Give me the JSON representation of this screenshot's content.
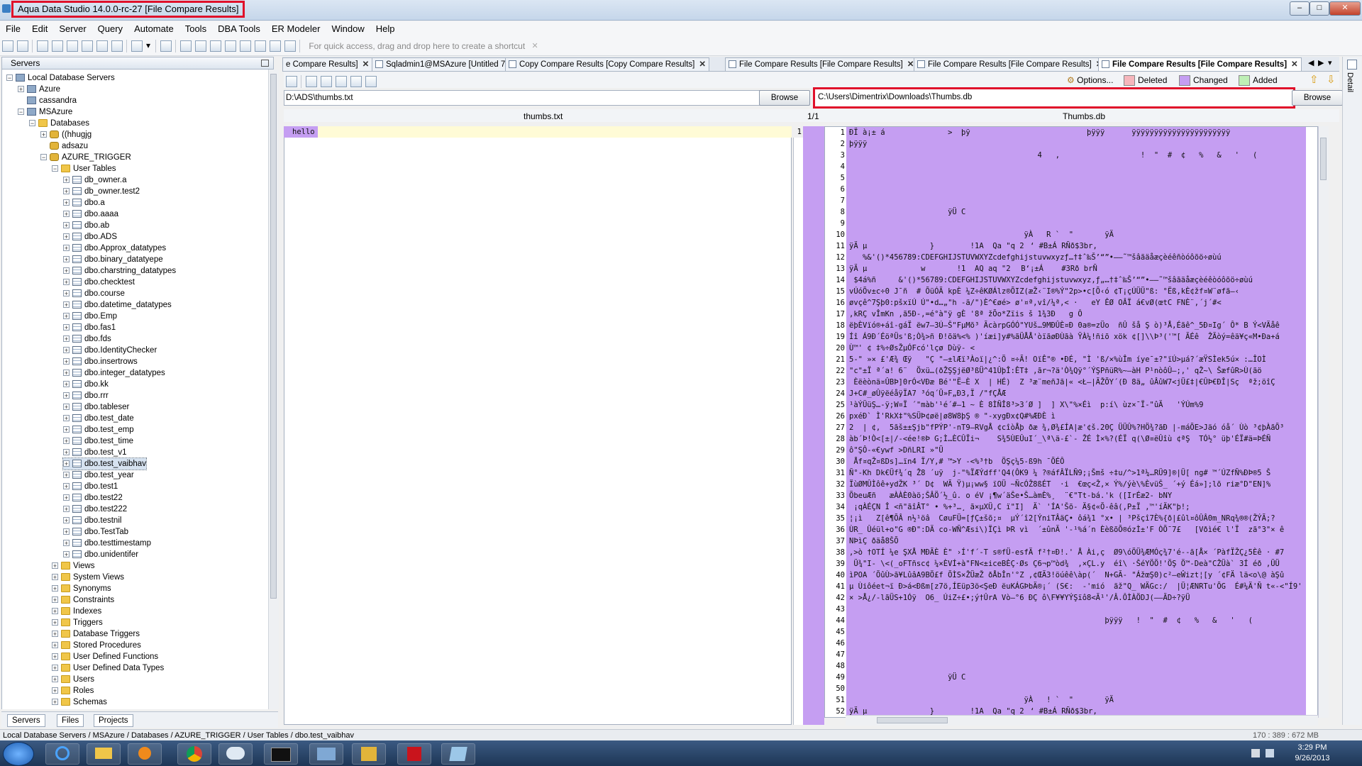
{
  "window": {
    "title": "Aqua Data Studio 14.0.0-rc-27 [File Compare Results]",
    "controls": [
      "–",
      "□",
      "✕"
    ]
  },
  "menu": [
    "File",
    "Edit",
    "Server",
    "Query",
    "Automate",
    "Tools",
    "DBA Tools",
    "ER Modeler",
    "Window",
    "Help"
  ],
  "toolbar": {
    "shortcut_hint": "For quick access, drag and drop here to create a shortcut",
    "close_x": "✕"
  },
  "servers_panel": {
    "title": "Servers",
    "tree": [
      {
        "label": "Local Database Servers",
        "level": 0,
        "icon": "server-icon",
        "expand": "−"
      },
      {
        "label": "Azure",
        "level": 1,
        "icon": "server-icon",
        "expand": "+"
      },
      {
        "label": "cassandra",
        "level": 1,
        "icon": "server-icon",
        "expand": ""
      },
      {
        "label": "MSAzure",
        "level": 1,
        "icon": "server-icon",
        "expand": "−"
      },
      {
        "label": "Databases",
        "level": 2,
        "icon": "folder-icon",
        "expand": "−"
      },
      {
        "label": "((hhugjg",
        "level": 3,
        "icon": "database-icon",
        "expand": "+"
      },
      {
        "label": "adsazu",
        "level": 3,
        "icon": "database-icon",
        "expand": ""
      },
      {
        "label": "AZURE_TRIGGER",
        "level": 3,
        "icon": "database-icon",
        "expand": "−"
      },
      {
        "label": "User Tables",
        "level": 4,
        "icon": "folder-icon",
        "expand": "−"
      },
      {
        "label": "db_owner.a",
        "level": 5,
        "icon": "table-icon",
        "expand": "+"
      },
      {
        "label": "db_owner.test2",
        "level": 5,
        "icon": "table-icon",
        "expand": "+"
      },
      {
        "label": "dbo.a",
        "level": 5,
        "icon": "table-icon",
        "expand": "+"
      },
      {
        "label": "dbo.aaaa",
        "level": 5,
        "icon": "table-icon",
        "expand": "+"
      },
      {
        "label": "dbo.ab",
        "level": 5,
        "icon": "table-icon",
        "expand": "+"
      },
      {
        "label": "dbo.ADS",
        "level": 5,
        "icon": "table-icon",
        "expand": "+"
      },
      {
        "label": "dbo.Approx_datatypes",
        "level": 5,
        "icon": "table-icon",
        "expand": "+"
      },
      {
        "label": "dbo.binary_datatyepe",
        "level": 5,
        "icon": "table-icon",
        "expand": "+"
      },
      {
        "label": "dbo.charstring_datatypes",
        "level": 5,
        "icon": "table-icon",
        "expand": "+"
      },
      {
        "label": "dbo.checktest",
        "level": 5,
        "icon": "table-icon",
        "expand": "+"
      },
      {
        "label": "dbo.course",
        "level": 5,
        "icon": "table-icon",
        "expand": "+"
      },
      {
        "label": "dbo.datetime_datatypes",
        "level": 5,
        "icon": "table-icon",
        "expand": "+"
      },
      {
        "label": "dbo.Emp",
        "level": 5,
        "icon": "table-icon",
        "expand": "+"
      },
      {
        "label": "dbo.fas1",
        "level": 5,
        "icon": "table-icon",
        "expand": "+"
      },
      {
        "label": "dbo.fds",
        "level": 5,
        "icon": "table-icon",
        "expand": "+"
      },
      {
        "label": "dbo.IdentityChecker",
        "level": 5,
        "icon": "table-icon",
        "expand": "+"
      },
      {
        "label": "dbo.insertrows",
        "level": 5,
        "icon": "table-icon",
        "expand": "+"
      },
      {
        "label": "dbo.integer_datatypes",
        "level": 5,
        "icon": "table-icon",
        "expand": "+"
      },
      {
        "label": "dbo.kk",
        "level": 5,
        "icon": "table-icon",
        "expand": "+"
      },
      {
        "label": "dbo.rrr",
        "level": 5,
        "icon": "table-icon",
        "expand": "+"
      },
      {
        "label": "dbo.tableser",
        "level": 5,
        "icon": "table-icon",
        "expand": "+"
      },
      {
        "label": "dbo.test_date",
        "level": 5,
        "icon": "table-icon",
        "expand": "+"
      },
      {
        "label": "dbo.test_emp",
        "level": 5,
        "icon": "table-icon",
        "expand": "+"
      },
      {
        "label": "dbo.test_time",
        "level": 5,
        "icon": "table-icon",
        "expand": "+"
      },
      {
        "label": "dbo.test_v1",
        "level": 5,
        "icon": "table-icon",
        "expand": "+"
      },
      {
        "label": "dbo.test_vaibhav",
        "level": 5,
        "icon": "table-icon",
        "expand": "+",
        "selected": true
      },
      {
        "label": "dbo.test_year",
        "level": 5,
        "icon": "table-icon",
        "expand": "+"
      },
      {
        "label": "dbo.test1",
        "level": 5,
        "icon": "table-icon",
        "expand": "+"
      },
      {
        "label": "dbo.test22",
        "level": 5,
        "icon": "table-icon",
        "expand": "+"
      },
      {
        "label": "dbo.test222",
        "level": 5,
        "icon": "table-icon",
        "expand": "+"
      },
      {
        "label": "dbo.testnil",
        "level": 5,
        "icon": "table-icon",
        "expand": "+"
      },
      {
        "label": "dbo.TestTab",
        "level": 5,
        "icon": "table-icon",
        "expand": "+"
      },
      {
        "label": "dbo.testtimestamp",
        "level": 5,
        "icon": "table-icon",
        "expand": "+"
      },
      {
        "label": "dbo.unidentifer",
        "level": 5,
        "icon": "table-icon",
        "expand": "+"
      },
      {
        "label": "Views",
        "level": 4,
        "icon": "folder-icon",
        "expand": "+"
      },
      {
        "label": "System Views",
        "level": 4,
        "icon": "folder-icon",
        "expand": "+"
      },
      {
        "label": "Synonyms",
        "level": 4,
        "icon": "folder-icon",
        "expand": "+"
      },
      {
        "label": "Constraints",
        "level": 4,
        "icon": "folder-icon",
        "expand": "+"
      },
      {
        "label": "Indexes",
        "level": 4,
        "icon": "folder-icon",
        "expand": "+"
      },
      {
        "label": "Triggers",
        "level": 4,
        "icon": "folder-icon",
        "expand": "+"
      },
      {
        "label": "Database Triggers",
        "level": 4,
        "icon": "folder-icon",
        "expand": "+"
      },
      {
        "label": "Stored Procedures",
        "level": 4,
        "icon": "folder-icon",
        "expand": "+"
      },
      {
        "label": "User Defined Functions",
        "level": 4,
        "icon": "folder-icon",
        "expand": "+"
      },
      {
        "label": "User Defined Data Types",
        "level": 4,
        "icon": "folder-icon",
        "expand": "+"
      },
      {
        "label": "Users",
        "level": 4,
        "icon": "folder-icon",
        "expand": "+"
      },
      {
        "label": "Roles",
        "level": 4,
        "icon": "folder-icon",
        "expand": "+"
      },
      {
        "label": "Schemas",
        "level": 4,
        "icon": "folder-icon",
        "expand": "+"
      }
    ],
    "bottom_tabs": [
      "Servers",
      "Files",
      "Projects"
    ]
  },
  "doc_tabs": [
    {
      "label": "e Compare Results]",
      "active": false
    },
    {
      "label": "Sqladmin1@MSAzure [Untitled 7]*",
      "active": false
    },
    {
      "label": "Copy Compare Results [Copy Compare Results]",
      "active": false
    },
    {
      "label": "File Compare Results [File Compare Results]",
      "active": false
    },
    {
      "label": "File Compare Results [File Compare Results]",
      "active": false
    },
    {
      "label": "File Compare Results [File Compare Results]",
      "active": true
    }
  ],
  "compare": {
    "options_label": "Options...",
    "legend": [
      {
        "label": "Deleted",
        "color": "#f6b6bc"
      },
      {
        "label": "Changed",
        "color": "#c59ef2"
      },
      {
        "label": "Added",
        "color": "#bff0b6"
      }
    ],
    "left_path": "D:\\ADS\\thumbs.txt",
    "right_path": "C:\\Users\\Dimentrix\\Downloads\\Thumbs.db",
    "browse_label": "Browse",
    "left_filename": "thumbs.txt",
    "right_filename": "Thumbs.db",
    "page_indicator": "1/1",
    "left_lines": [
      {
        "num": "1",
        "text": "hello"
      }
    ],
    "right_lines": [
      {
        "num": "1",
        "text": "ÐÏ à¡± á              >  þÿ                          þÿÿÿ      ÿÿÿÿÿÿÿÿÿÿÿÿÿÿÿÿÿÿÿÿÿÿ"
      },
      {
        "num": "2",
        "text": "þÿÿÿ"
      },
      {
        "num": "3",
        "text": "                                          4   ,                  !  \"  #  ¢   %   &   '   ("
      },
      {
        "num": "4",
        "text": ""
      },
      {
        "num": "5",
        "text": ""
      },
      {
        "num": "6",
        "text": ""
      },
      {
        "num": "7",
        "text": ""
      },
      {
        "num": "8",
        "text": "                      ÿÜ C"
      },
      {
        "num": "9",
        "text": ""
      },
      {
        "num": "10",
        "text": "                                       ÿÀ   R `  \"       ÿÄ"
      },
      {
        "num": "11",
        "text": "ÿÄ µ              }        !1A  Qa \"q 2‘ #B±Á RÑð$3br‚"
      },
      {
        "num": "12",
        "text": "   %&'()*456789:CDEFGHIJSTUVWXYZcdefghijstuvwxyzƒ…†‡ˆ‰Š’“”•–—˜™šâãäåæçèéêñòóôõö÷øùú"
      },
      {
        "num": "13",
        "text": "ÿÄ µ            w       !1  AQ aq \"2 B‘¡±Á    #3Rð brÑ"
      },
      {
        "num": "14",
        "text": " $4á%ñ     &'()*56789:CDEFGHIJSTUVWXYZcdefghijstuvwxyz‚ƒ„…†‡ˆ‰Š’“”•–—˜™šâãäåæçèéêòóôõö÷øùú"
      },
      {
        "num": "15",
        "text": "vÚóÕv±c÷0 J¯ñ  # ÕüÓÄ kpÈ ¼Z÷êKØÁlz®ÕIZ(æŽ‹¨I®%Ý\"2p>•c[Õ‹ó ¢T¡çÚÜÜ\"ß: °Ëß,kÈ¢žf¤W¨øfã—‹"
      },
      {
        "num": "16",
        "text": "øvçê^7Şþ0:pšxïÚ Ú\"•d…„\"h -ä/\")È^€øé> ø'¤ª,vî/¼ª‚< ·   eY ÊØ OÂÏ á€vØ(œtC FNÈ¨,´j´#<"
      },
      {
        "num": "17",
        "text": ",kRÇ vÎmKn ,ã5Ð-,=é°à\"ÿ gÈ '8ª žÕo*Zïis š 1¾3Ð   g Ô"
      },
      {
        "num": "18",
        "text": "ëþÈVïó®+áî-gáÏ ëw7—3Ú—Š\"FµMõ³ ÃcàrpGÓÓ\"YUš…9MÐÛÈ¤Ð 0a®=zÜo  ñÛ šå Ş ò)³Å,Éãê^_5Ð¤Ig´ Ô* B Ý<VÄåê"
      },
      {
        "num": "19",
        "text": "Íî Á9Ð´ÉöªÜs'ß;Ò¾>ñ Ð!õä%<% )'íæi]y#%ãÜÅÅ'òïãøÐÙãà ŸÀ¼!ñiõ xök ¢[]\\\\Þ³('™[ ÃÉê  ŽÃòý=êä¥ç«M•Ða+á"
      },
      {
        "num": "20",
        "text": "Ù™' ¢ ‡%÷ØsŽµÓFcó'lçø Dùÿ- <"
      },
      {
        "num": "21",
        "text": "5-\" »× £'Æ¾ Œÿ   \"Ç \"—±lÆï³Àoï|¿^:Ö ¤÷Ã! OïÊ\"® •ÐÉ‚ \"Ì 'ß/×%ùÎm íye¯±?\"ïÚ>µá?´æŸSÌek5ú× :…ÎOÌ"
      },
      {
        "num": "22",
        "text": "\"c\"±Ï ª´a! 6¨  Öxü…(ðŽŞŞjëØ³ßÜ^41ÛþÎ:ÊT‡ ,ãr¬?ä'Ò¾Qÿ°´ÝŞPñüR%~—àH P¹nòôÛ—;,' qŽ~\\ ŠæfûR>Ù(ãö"
      },
      {
        "num": "23",
        "text": " Èëèònä¤ÛBÞ]0rÓ<VÐæ Bé'\"Ë—È X  | HÉ)  Z ³æ¨meñJã|« <Ł—|ÃŽÖY´(Ð 8ä„ ûÂûW7<jÜ£‡|€ÛÞ€ÐÎ|Sç  ªž;öîÇ"
      },
      {
        "num": "24",
        "text": "J+C#_øÛÿëéåÿÏA7 ³óq´Ü»F„Ð3,Ï /\"fÇÅÆ"
      },
      {
        "num": "25",
        "text": "¹àÝÜüŞ…-ÿ;W¤Ï ´\"màb'¹é´#—1 ~ È 8ÌÑÎ8³>3´Ø ]  ] X\\\"%×Éì  p:í\\ ùz×¯Ï-\"ûÄ   'ÝÚm%9"
      },
      {
        "num": "26",
        "text": "pxéÐ` Ì'RkX‡\"%SÜÞ¢øë|ø8W8þŞ ® \"-xygÐx¢Q#%ÆÐÈ ì"
      },
      {
        "num": "27",
        "text": "2  | ¢,  5ãš±±Şjb\"fPÝP'-nT9—RVgÅ ¢cîòÅþ ðæ ¾,Ø¾£ÍA|æ'¢š.20Ç ÜÜÛ%?HÖ¾?ãÐ |-máÕE>Jäó óå´ Ùò ³¢þÀãÕ³"
      },
      {
        "num": "28",
        "text": "àb´Þ!Ò<[±|/-<ée!®Þ G;Ì…ÈCÛÏi¬    S¾5ÙEÛuI´_\\ª\\ä-£`- ŽÉ Ì×%?(ÉÏ q(\\Ø¤ëÛîù ¢ªŞ  TÓ½° üþ'ÉÏ#ä=ÞÉÑ"
      },
      {
        "num": "29",
        "text": "ô\"ŞÔ-«€ywf >DñLRI »\"Ü"
      },
      {
        "num": "30",
        "text": " Åf¤qŽ¤ßDs]…ïn4 Ï/Y,# ™>Y -<%³†b  ÖŞç¼5-ß9h ¯ÕÉÔ"
      },
      {
        "num": "31",
        "text": "Ñ°-Kh Dk€Üf¾´q Ž8 ´uÿ  j-\"%ÏÆÝdff'Q4(ÔK9 ¼ ?®áfÂÏLÑ9;¡Šmš ÷‡u/^>1ª¼…RÜ9]®|Ü[ ng# ™´ÚZfÑ%ÐÞ®5 Š"
      },
      {
        "num": "32",
        "text": "ÏùØMÛÌôê+ydŽK ³´ D¢  WÃ Ÿ)µ¡ww§ ïOÜ ~ÑcÓŽ8ßÉT  ·i  €œç<Ž,× Ý%/ýè\\%ÈvüŠ_ ´+ý Éá»];lõ riæ°D\"EN]%"
      },
      {
        "num": "33",
        "text": "ÕbeuÆñ   æÀÀÈ0àö;ŠÂÖ´½_û. o éV ¡¶w´äŠe•Š…àmÈ%¸  ¨€\"Tt-bá.'k ([IrÉæ2- bNY"
      },
      {
        "num": "34",
        "text": " ¡qÀÉÇN Î <ñ\"ãîÂT° • %+³…¸ ã×µXÜ‚C ï\"I]  Ä` 'ÍA'Šõ- Ä§¢«Õ-êâ(‚P±Ï ,™'íÄK\"þ!;"
      },
      {
        "num": "35",
        "text": "¦¡ì   Z[ê¶ÕÂ n½¹öâ  CøuFÜ=[ƒÇ±šõ;¤  µÝ´î2[ÝniTÂäÇ• ôá¾1 °x• | ³Pšçî7È%{ð|£ûl¤ôÛÂ0m_NRq¾®®(ŽÝÃ;?"
      },
      {
        "num": "36",
        "text": "ÙR_ Ûéül+o\"G ®Ð\":DÄ co-WÑ^Æsi\\)ÏÇì ÞR vì  ´±ûnÃ '-¹%á´n ÈèßõÕ®ózÌ±'F ÒÕ¯7£   [Vðìé€ l'Ï  zã°3\"× ê"
      },
      {
        "num": "37",
        "text": "NÞìÇ ðäå8ŠÕ"
      },
      {
        "num": "38",
        "text": ",>ò †OTÍ ¼e ŞXÅ MÐÃÈ È\" ›Í'f´-T s®fÜ-esfÄ f²†¤Ð!.' Å Ài,ç  Ø9\\óÖÜ¾ÆMÓç¾7'é--ã[Å× ´PàfÏŽÇ¿5Èê · #7"
      },
      {
        "num": "39",
        "text": " Ü¾\"I- \\<(_oFTñsc¢ ¼×ÈVÍ+à\"FN<±iceBÈÇ·Øs Ç6¬p™òd¾  ,×ÇL.y  éî\\ ·ŠéYÖÖ!'ÖŞ Ö™-Deà\"CŽÜà` 3Í éð ,ÜÜ"
      },
      {
        "num": "40",
        "text": "ìPOA ´ÕûÙ>ã¥LûâA9BÖ£f ÕÌS×ŽÜæŽ ðÅbÎn'°Z ,¢ŒÃ3!öúêê\\àp(´  N+GÃ- \"ÁžœŞ0)c²—eŴizt¦[y ´¢FÄ lä<o\\@ àŞû"
      },
      {
        "num": "41",
        "text": "µ Ùiôéet¬ï Ð>á<Ðßm[z7ö,ÍEüp3ö<ŞeÐ ëuKÁGÞbÄ®¡´ (S€:  -'mió  ãž\"Q_ WÄGc:/  |Ü¦ÆNRTu'ÕG  É#¼Ä'Ñ t«-<\"Í9'"
      },
      {
        "num": "42",
        "text": "× >Å¿/-lãÜS+1Óÿ  O6_ ÚiZ÷£•;ý†ÛrA Vò—°6 ÐÇ ô\\F¥¥YÝŞïô8<Ã¹'/Â.ÔÌÀÖDJ(——ÃD÷?ÿÜ"
      },
      {
        "num": "43",
        "text": ""
      },
      {
        "num": "44",
        "text": "                                                         þÿÿÿ   !  \"  #  ¢   %   &   '   ("
      },
      {
        "num": "45",
        "text": ""
      },
      {
        "num": "46",
        "text": ""
      },
      {
        "num": "47",
        "text": ""
      },
      {
        "num": "48",
        "text": ""
      },
      {
        "num": "49",
        "text": "                      ÿÜ C"
      },
      {
        "num": "50",
        "text": ""
      },
      {
        "num": "51",
        "text": "                                       ÿÀ   ! `  \"       ÿÄ"
      },
      {
        "num": "52",
        "text": "ÿÄ µ              }        !1A  Qa \"q 2‘ #B±Á RÑð$3br‚"
      }
    ]
  },
  "status": {
    "path": "Local Database Servers / MSAzure / Databases / AZURE_TRIGGER / User Tables / dbo.test_vaibhav",
    "memory": "170 : 389 : 672 MB"
  },
  "right_dock": {
    "label": "Detail"
  },
  "taskbar": {
    "time": "3:29 PM",
    "date": "9/26/2013"
  }
}
